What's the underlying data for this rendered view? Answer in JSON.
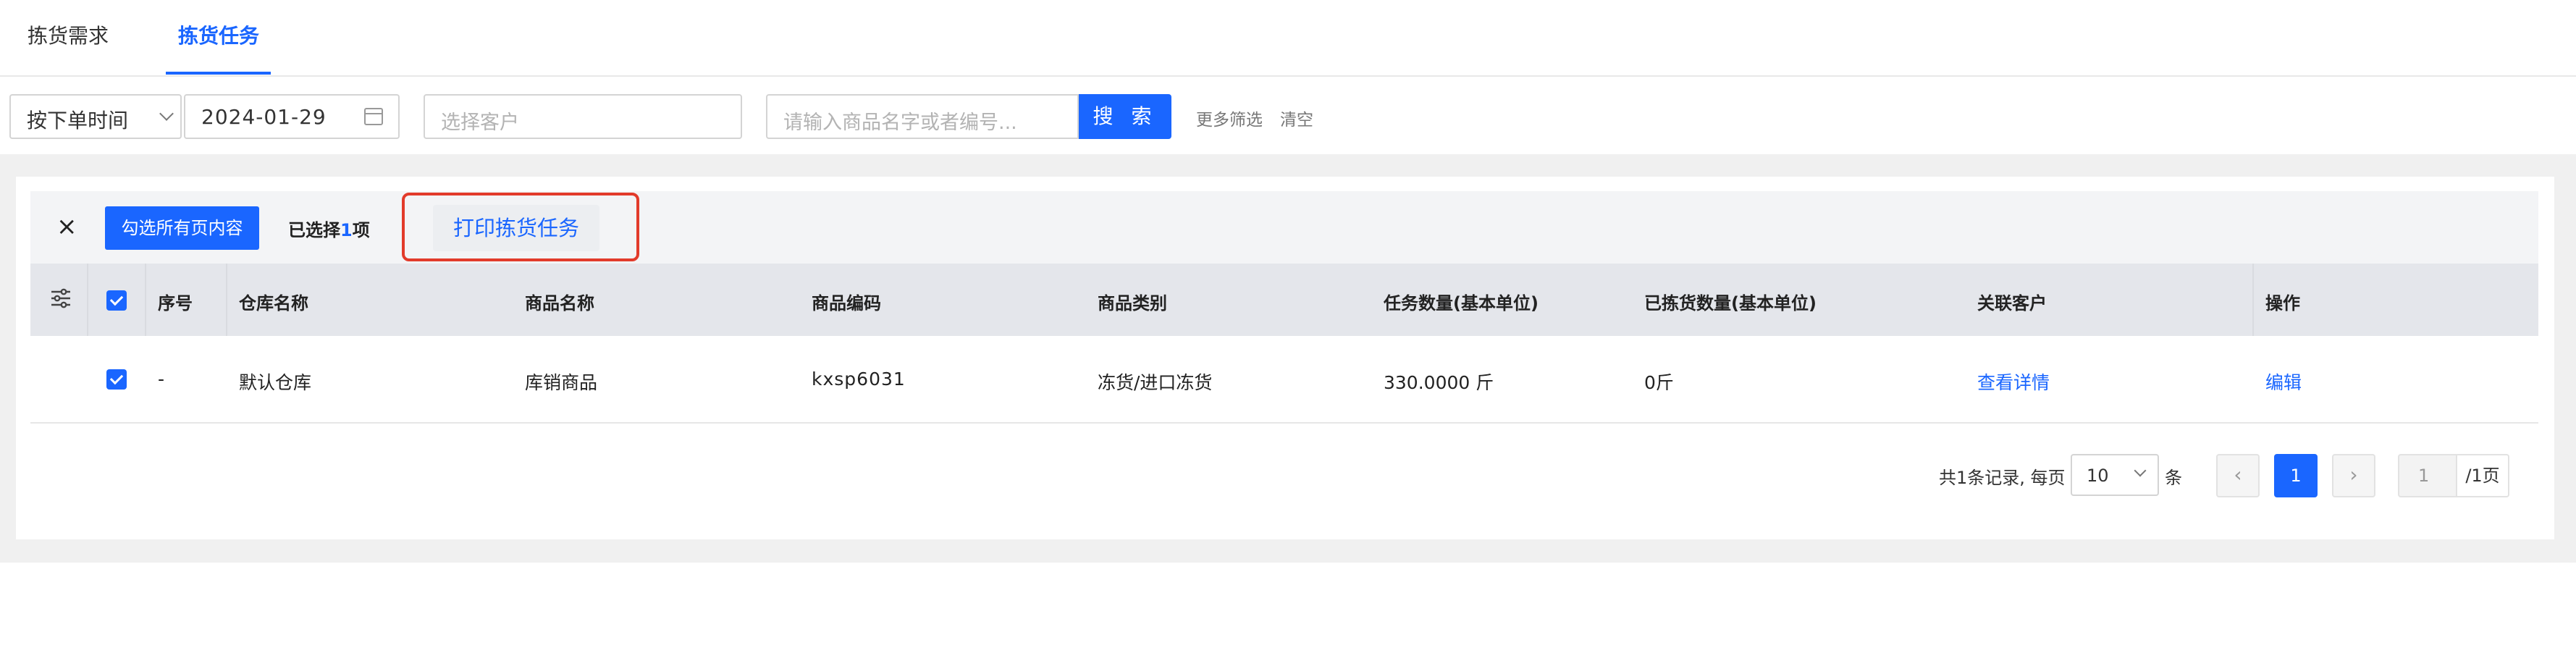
{
  "tabs": [
    {
      "label": "拣货需求",
      "active": false
    },
    {
      "label": "拣货任务",
      "active": true
    }
  ],
  "filters": {
    "order_time_select": "按下单时间",
    "date": "2024-01-29",
    "customer_placeholder": "选择客户",
    "search_placeholder": "请输入商品名字或者编号...",
    "search_button": "搜 索",
    "more_filters": "更多筛选",
    "clear": "清空"
  },
  "selection_bar": {
    "close": "×",
    "select_all_pages": "勾选所有页内容",
    "selected_prefix": "已选择",
    "selected_count": "1",
    "selected_suffix": "项",
    "print_button": "打印拣货任务"
  },
  "table": {
    "headers": [
      "序号",
      "仓库名称",
      "商品名称",
      "商品编码",
      "商品类别",
      "任务数量(基本单位)",
      "已拣货数量(基本单位)",
      "关联客户",
      "操作"
    ],
    "rows": [
      {
        "index": "-",
        "warehouse": "默认仓库",
        "product_name": "库销商品",
        "product_code": "kxsp6031",
        "category": "冻货/进口冻货",
        "task_qty": "330.0000 斤",
        "picked_qty": "0斤",
        "customer": "查看详情",
        "action": "编辑",
        "checked": true
      }
    ]
  },
  "pagination": {
    "total_text": "共1条记录, 每页",
    "page_size": "10",
    "unit": "条",
    "prev": "‹",
    "current": "1",
    "next": "›",
    "page_input": "1",
    "page_of": "/1页"
  },
  "colors": {
    "primary": "#1a66ff",
    "highlight_border": "#e23b2b"
  }
}
